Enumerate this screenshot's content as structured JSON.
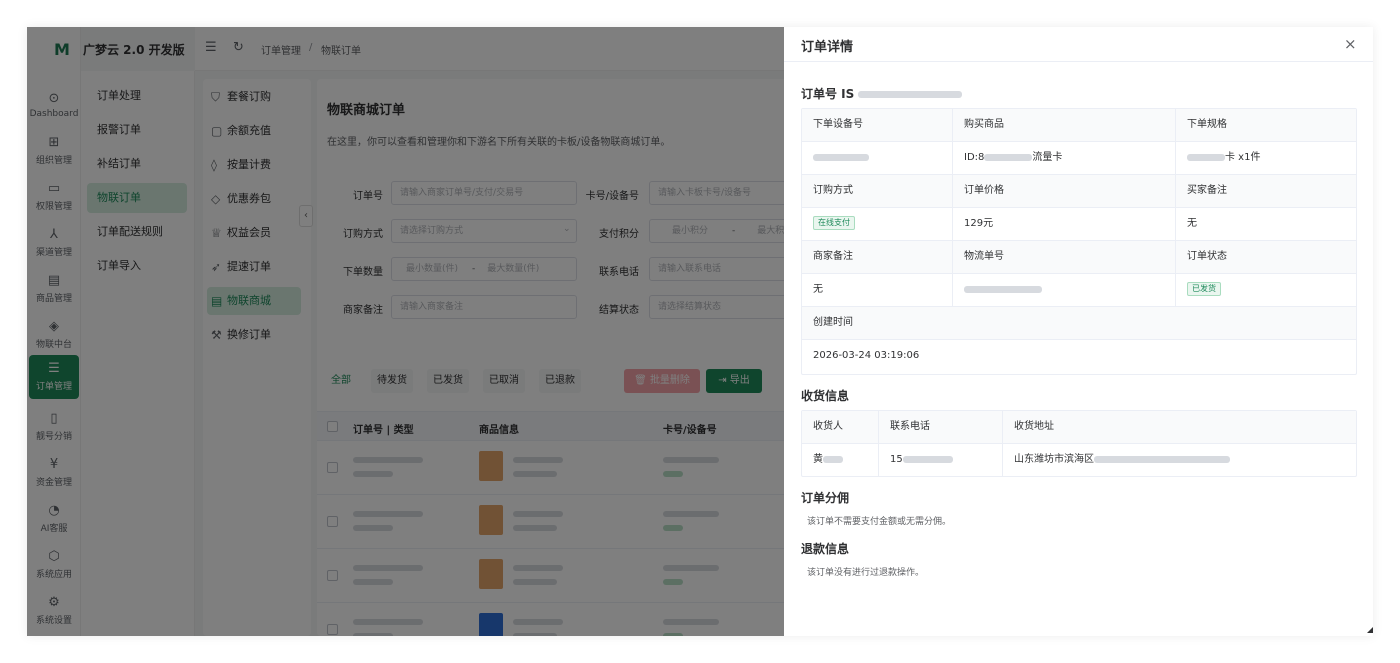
{
  "app": {
    "logo_mark": "M",
    "title": "广梦云 2.0 开发版"
  },
  "rail": [
    {
      "icon": "⊙",
      "label": "Dashboard",
      "icon_name": "dashboard-icon"
    },
    {
      "icon": "⊞",
      "label": "组织管理",
      "icon_name": "grid-icon"
    },
    {
      "icon": "▭",
      "label": "权限管理",
      "icon_name": "monitor-icon"
    },
    {
      "icon": "⅄",
      "label": "渠道管理",
      "icon_name": "network-icon"
    },
    {
      "icon": "▤",
      "label": "商品管理",
      "icon_name": "store-icon"
    },
    {
      "icon": "◈",
      "label": "物联中台",
      "icon_name": "cube-icon"
    },
    {
      "icon": "☰",
      "label": "订单管理",
      "icon_name": "list-icon"
    },
    {
      "icon": "▯",
      "label": "靓号分销",
      "icon_name": "phone-icon"
    },
    {
      "icon": "¥",
      "label": "资金管理",
      "icon_name": "yuan-icon"
    },
    {
      "icon": "◔",
      "label": "AI客服",
      "icon_name": "ai-service-icon"
    },
    {
      "icon": "⬡",
      "label": "系统应用",
      "icon_name": "package-icon"
    },
    {
      "icon": "⚙",
      "label": "系统设置",
      "icon_name": "gear-icon"
    }
  ],
  "submenu": [
    "订单处理",
    "报警订单",
    "补结订单",
    "物联订单",
    "订单配送规则",
    "订单导入"
  ],
  "topbar": {
    "breadcrumb_1": "订单管理",
    "separator": "/",
    "breadcrumb_2": "物联订单"
  },
  "col3": [
    {
      "icon": "⛉",
      "label": "套餐订购",
      "icon_name": "cart-icon"
    },
    {
      "icon": "▢",
      "label": "余额充值",
      "icon_name": "wallet-icon"
    },
    {
      "icon": "◊",
      "label": "按量计费",
      "icon_name": "drop-icon"
    },
    {
      "icon": "◇",
      "label": "优惠券包",
      "icon_name": "tag-icon"
    },
    {
      "icon": "♕",
      "label": "权益会员",
      "icon_name": "crown-icon"
    },
    {
      "icon": "➶",
      "label": "提速订单",
      "icon_name": "rocket-icon"
    },
    {
      "icon": "▤",
      "label": "物联商城",
      "icon_name": "doc-icon"
    },
    {
      "icon": "⚒",
      "label": "换修订单",
      "icon_name": "hammer-icon"
    }
  ],
  "main": {
    "title": "物联商城订单",
    "desc": "在这里，你可以查看和管理你和下游名下所有关联的卡板/设备物联商城订单。",
    "filters": {
      "order_no": {
        "label": "订单号",
        "placeholder": "请输入商家订单号/支付/交易号"
      },
      "card_no": {
        "label": "卡号/设备号",
        "placeholder": "请输入卡板卡号/设备号"
      },
      "buy_method": {
        "label": "订购方式",
        "placeholder": "请选择订购方式"
      },
      "points": {
        "label": "支付积分",
        "min": "最小积分",
        "dash": "-",
        "max": "最大积"
      },
      "qty": {
        "label": "下单数量",
        "min": "最小数量(件)",
        "dash": "-",
        "max": "最大数量(件)"
      },
      "phone": {
        "label": "联系电话",
        "placeholder": "请输入联系电话"
      },
      "merchant_note": {
        "label": "商家备注",
        "placeholder": "请输入商家备注"
      },
      "settle": {
        "label": "结算状态",
        "placeholder": "请选择结算状态"
      }
    },
    "tabs": [
      "全部",
      "待发货",
      "已发货",
      "已取消",
      "已退款"
    ],
    "batch_delete": "批量删除",
    "export": "导出",
    "columns": [
      "订单号 | 类型",
      "商品信息",
      "卡号/设备号"
    ]
  },
  "drawer": {
    "title": "订单详情",
    "close": "×",
    "order_no_label": "订单号 IS",
    "grid": {
      "h1": [
        "下单设备号",
        "购买商品",
        "下单规格"
      ],
      "r1": {
        "c2_prefix": "ID:8",
        "c2_suffix": "流量卡",
        "c3_suffix": "卡 x1件"
      },
      "h2": [
        "订购方式",
        "订单价格",
        "买家备注"
      ],
      "r2": {
        "pay_tag": "在线支付",
        "price": "129元",
        "buyer_note": "无"
      },
      "h3": [
        "商家备注",
        "物流单号",
        "订单状态"
      ],
      "r3": {
        "merchant_note": "无",
        "status_tag": "已发货"
      },
      "h4": "创建时间",
      "r4": "2026-03-24 03:19:06"
    },
    "shipping": {
      "title": "收货信息",
      "headers": [
        "收货人",
        "联系电话",
        "收货地址"
      ],
      "name_prefix": "黄",
      "phone_prefix": "15",
      "address_prefix": "山东潍坊市滨海区"
    },
    "commission": {
      "title": "订单分佣",
      "note": "该订单不需要支付金额或无需分佣。"
    },
    "refund": {
      "title": "退款信息",
      "note": "该订单没有进行过退款操作。"
    }
  },
  "colors": {
    "primary": "#1f8a5b",
    "danger_light": "#f4a3a8",
    "mask": "rgba(0,0,0,0.5)"
  }
}
